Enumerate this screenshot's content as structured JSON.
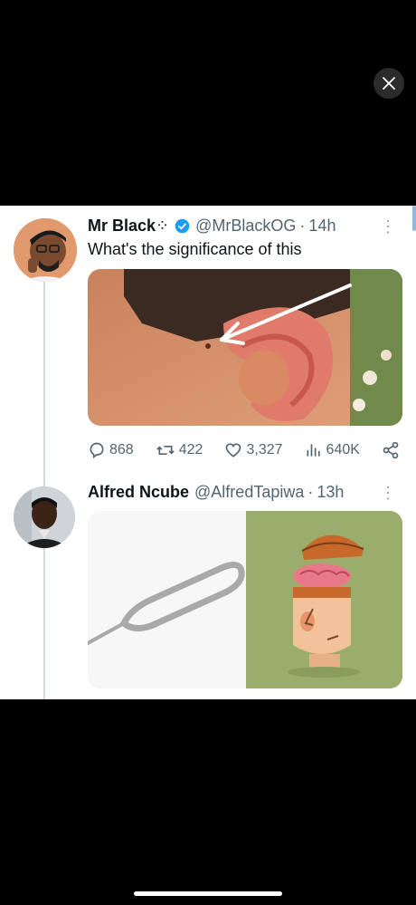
{
  "viewer": {
    "close_icon": "close-icon"
  },
  "tweet1": {
    "name": "Mr Black",
    "name_emoji": "⁘",
    "verified_icon": "verified-badge-icon",
    "handle": "@MrBlackOG",
    "separator": "·",
    "time": "14h",
    "text": "What's the significance of this",
    "media": "photo of an ear with a small hole, arrow pointing at it",
    "actions": {
      "replies": "868",
      "retweets": "422",
      "likes": "3,327",
      "views": "640K"
    }
  },
  "tweet2": {
    "name": "Alfred Ncube",
    "handle": "@AlfredTapiwa",
    "separator": "·",
    "time": "13h",
    "media_left": "SIM ejector pin",
    "media_right": "cartoon head with open lid showing brain"
  },
  "colors": {
    "verified": "#1d9bf0",
    "text": "#0f1419",
    "muted": "#536471",
    "thread_line": "#cfd9de"
  }
}
